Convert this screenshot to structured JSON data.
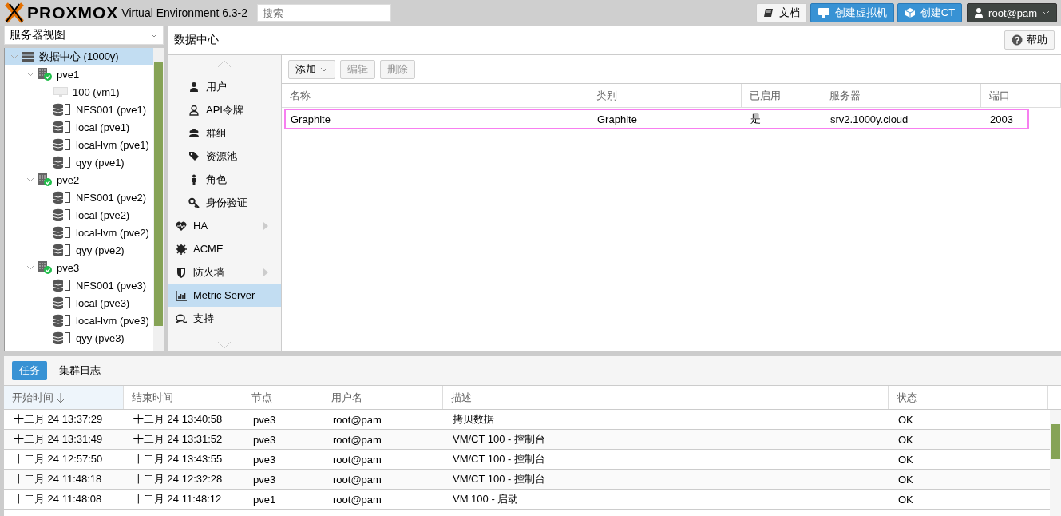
{
  "header": {
    "logo": "PROXMOX",
    "product": "Virtual Environment 6.3-2",
    "search": {
      "placeholder": "搜索"
    },
    "buttons": [
      {
        "kind": "docs",
        "label": "文档"
      },
      {
        "kind": "vm",
        "label": "创建虚拟机"
      },
      {
        "kind": "ct",
        "label": "创建CT"
      },
      {
        "kind": "user",
        "label": "root@pam"
      }
    ]
  },
  "view_select": {
    "value": "服务器视图"
  },
  "tree": [
    {
      "kind": "datacenter",
      "label": "数据中心 (1000y)",
      "selected": true,
      "expanded": true,
      "children": [
        {
          "kind": "node",
          "label": "pve1",
          "selected": false,
          "expanded": true,
          "children": [
            {
              "kind": "vm",
              "label": "100 (vm1)",
              "selected": false
            },
            {
              "kind": "storage",
              "label": "NFS001 (pve1)",
              "selected": false
            },
            {
              "kind": "storage",
              "label": "local (pve1)",
              "selected": false
            },
            {
              "kind": "storage",
              "label": "local-lvm (pve1)",
              "selected": false
            },
            {
              "kind": "storage",
              "label": "qyy (pve1)",
              "selected": false
            }
          ]
        },
        {
          "kind": "node",
          "label": "pve2",
          "selected": false,
          "expanded": true,
          "children": [
            {
              "kind": "storage",
              "label": "NFS001 (pve2)",
              "selected": false
            },
            {
              "kind": "storage",
              "label": "local (pve2)",
              "selected": false
            },
            {
              "kind": "storage",
              "label": "local-lvm (pve2)",
              "selected": false
            },
            {
              "kind": "storage",
              "label": "qyy (pve2)",
              "selected": false
            }
          ]
        },
        {
          "kind": "node",
          "label": "pve3",
          "selected": false,
          "expanded": true,
          "children": [
            {
              "kind": "storage",
              "label": "NFS001 (pve3)",
              "selected": false
            },
            {
              "kind": "storage",
              "label": "local (pve3)",
              "selected": false
            },
            {
              "kind": "storage",
              "label": "local-lvm (pve3)",
              "selected": false
            },
            {
              "kind": "storage",
              "label": "qyy (pve3)",
              "selected": false
            }
          ]
        }
      ]
    }
  ],
  "content": {
    "title": "数据中心",
    "help": "帮助",
    "menu": [
      {
        "kind": "user",
        "label": "用户",
        "selected": false,
        "submenu": false,
        "indent": true
      },
      {
        "kind": "token",
        "label": "API令牌",
        "selected": false,
        "submenu": false,
        "indent": true
      },
      {
        "kind": "group",
        "label": "群组",
        "selected": false,
        "submenu": false,
        "indent": true
      },
      {
        "kind": "tags",
        "label": "资源池",
        "selected": false,
        "submenu": false,
        "indent": true
      },
      {
        "kind": "role",
        "label": "角色",
        "selected": false,
        "submenu": false,
        "indent": true
      },
      {
        "kind": "key",
        "label": "身份验证",
        "selected": false,
        "submenu": false,
        "indent": true
      },
      {
        "kind": "heart",
        "label": "HA",
        "selected": false,
        "submenu": true,
        "indent": false
      },
      {
        "kind": "cert",
        "label": "ACME",
        "selected": false,
        "submenu": false,
        "indent": false
      },
      {
        "kind": "shield",
        "label": "防火墙",
        "selected": false,
        "submenu": true,
        "indent": false
      },
      {
        "kind": "chart",
        "label": "Metric Server",
        "selected": true,
        "submenu": false,
        "indent": false
      },
      {
        "kind": "chat",
        "label": "支持",
        "selected": false,
        "submenu": false,
        "indent": false
      }
    ],
    "toolbar": [
      {
        "label": "添加",
        "disabled": false,
        "dropdown": true
      },
      {
        "label": "编辑",
        "disabled": true,
        "dropdown": false
      },
      {
        "label": "删除",
        "disabled": true,
        "dropdown": false
      }
    ],
    "table": {
      "columns": [
        "名称",
        "类别",
        "已启用",
        "服务器",
        "端口"
      ],
      "rows": [
        {
          "cells": [
            "Graphite",
            "Graphite",
            "是",
            "srv2.1000y.cloud",
            "2003"
          ],
          "selected": true
        }
      ]
    }
  },
  "tasks": {
    "tabs": [
      {
        "label": "任务",
        "selected": true
      },
      {
        "label": "集群日志",
        "selected": false
      }
    ],
    "columns": [
      {
        "label": "开始时间",
        "sorted": true
      },
      {
        "label": "结束时间",
        "sorted": false
      },
      {
        "label": "节点",
        "sorted": false
      },
      {
        "label": "用户名",
        "sorted": false
      },
      {
        "label": "描述",
        "sorted": false
      },
      {
        "label": "状态",
        "sorted": false
      }
    ],
    "rows": [
      [
        "十二月 24 13:37:29",
        "十二月 24 13:40:58",
        "pve3",
        "root@pam",
        "拷贝数据",
        "OK"
      ],
      [
        "十二月 24 13:31:49",
        "十二月 24 13:31:52",
        "pve3",
        "root@pam",
        "VM/CT 100 - 控制台",
        "OK"
      ],
      [
        "十二月 24 12:57:50",
        "十二月 24 13:43:55",
        "pve3",
        "root@pam",
        "VM/CT 100 - 控制台",
        "OK"
      ],
      [
        "十二月 24 11:48:18",
        "十二月 24 12:32:28",
        "pve3",
        "root@pam",
        "VM/CT 100 - 控制台",
        "OK"
      ],
      [
        "十二月 24 11:48:08",
        "十二月 24 11:48:12",
        "pve1",
        "root@pam",
        "VM 100 - 启动",
        "OK"
      ]
    ]
  }
}
